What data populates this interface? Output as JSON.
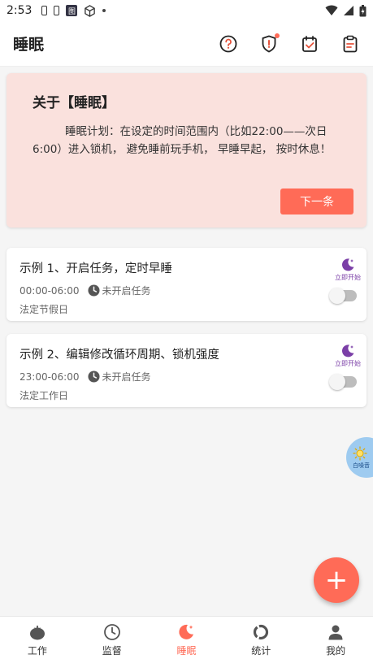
{
  "statusbar": {
    "time": "2:53",
    "box_glyph": "图"
  },
  "appbar": {
    "title": "睡眠"
  },
  "intro": {
    "heading": "关于【睡眠】",
    "text": "睡眠计划：在设定的时间范围内（比如22:00——次日6:00）进入锁机， 避免睡前玩手机， 早睡早起， 按时休息！",
    "next_label": "下一条"
  },
  "plans": [
    {
      "title": "示例 1、开启任务，定时早睡",
      "range": "00:00-06:00",
      "status": "未开启任务",
      "days": "法定节假日",
      "start_label": "立即开始",
      "enabled": false
    },
    {
      "title": "示例 2、编辑修改循环周期、锁机强度",
      "range": "23:00-06:00",
      "status": "未开启任务",
      "days": "法定工作日",
      "start_label": "立即开始",
      "enabled": false
    }
  ],
  "float_button": {
    "label": "白噪音"
  },
  "fab": {
    "label": "+"
  },
  "nav": [
    {
      "label": "工作",
      "icon": "tomato-icon"
    },
    {
      "label": "监督",
      "icon": "clock-icon"
    },
    {
      "label": "睡眠",
      "icon": "moon-icon"
    },
    {
      "label": "统计",
      "icon": "ring-chart-icon"
    },
    {
      "label": "我的",
      "icon": "person-icon"
    }
  ],
  "colors": {
    "accent": "#ff6b57",
    "intro_bg": "#fae1dd",
    "purple": "#7b3fa7"
  }
}
